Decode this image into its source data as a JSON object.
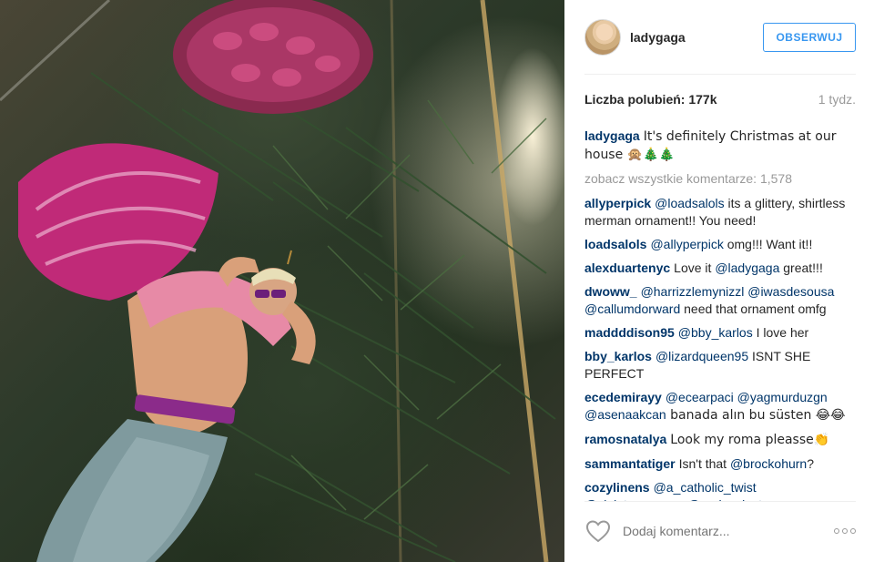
{
  "post": {
    "image_alt": "merman-ornament-photo"
  },
  "header": {
    "username": "ladygaga",
    "follow_label": "OBSERWUJ"
  },
  "stats": {
    "likes": "Liczba polubień: 177k",
    "time": "1 tydz."
  },
  "caption": {
    "user": "ladygaga",
    "text": "It's definitely Christmas at our house 🙊🎄🎄"
  },
  "view_all": "zobacz wszystkie komentarze: 1,578",
  "comments": [
    {
      "user": "allyperpick",
      "mention": "@loadsalols",
      "text": " its a glittery, shirtless merman ornament!! You need!"
    },
    {
      "user": "loadsalols",
      "mention": "@allyperpick",
      "text": " omg!!! Want it!!"
    },
    {
      "user": "alexduartenyc",
      "mention": "",
      "text": "Love it ",
      "mention2": "@ladygaga",
      "text2": " great!!!"
    },
    {
      "user": "dwoww_",
      "mention": "@harrizzlemynizzl @iwasdesousa @callumdorward",
      "text": " need that ornament omfg"
    },
    {
      "user": "maddddison95",
      "mention": "@bby_karlos",
      "text": " I love her"
    },
    {
      "user": "bby_karlos",
      "mention": "@lizardqueen95",
      "text": " ISNT SHE PERFECT"
    },
    {
      "user": "ecedemirayy",
      "mention": "@ecearpaci @yagmurduzgn @asenaakcan",
      "text": " banada alın bu süsten 😂😂"
    },
    {
      "user": "ramosnatalya",
      "mention": "",
      "text": "Look my roma pleasse👏"
    },
    {
      "user": "sammantatiger",
      "mention": "",
      "text": "Isn't that ",
      "mention2": "@brockohurn",
      "text2": "?"
    },
    {
      "user": "cozylinens",
      "mention": "@a_catholic_twist @violetacarmona @real_velvet",
      "text": ""
    }
  ],
  "footer": {
    "comment_placeholder": "Dodaj komentarz..."
  },
  "colors": {
    "link": "#003569",
    "accent": "#3897f0",
    "muted": "#999999"
  }
}
